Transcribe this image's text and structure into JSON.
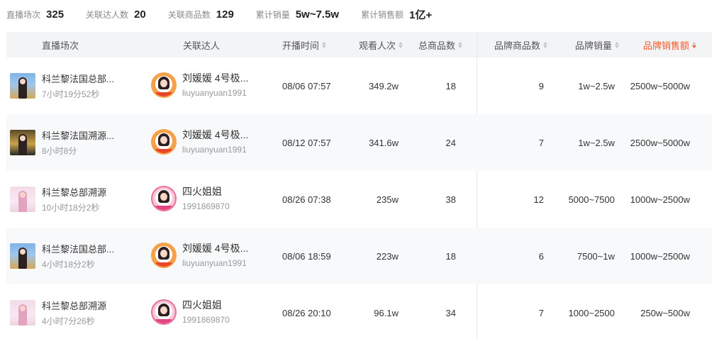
{
  "summary": [
    {
      "label": "直播场次",
      "value": "325"
    },
    {
      "label": "关联达人数",
      "value": "20"
    },
    {
      "label": "关联商品数",
      "value": "129"
    },
    {
      "label": "累计销量",
      "value": "5w~7.5w"
    },
    {
      "label": "累计销售额",
      "value": "1亿+"
    }
  ],
  "columns": {
    "live": "直播场次",
    "author": "关联达人",
    "start_time": "开播时间",
    "views": "观看人次",
    "total_products": "总商品数",
    "brand_products": "品牌商品数",
    "brand_sales": "品牌销量",
    "brand_revenue": "品牌销售额"
  },
  "active_sort_color": "#f05a28",
  "rows": [
    {
      "thumb": "tv",
      "title": "科兰黎法国总部...",
      "duration": "7小时19分52秒",
      "avatar": "orange",
      "author": "刘媛媛 4号极...",
      "author_id": "liuyuanyuan1991",
      "start_time": "08/06 07:57",
      "views": "349.2w",
      "total_products": "18",
      "brand_products": "9",
      "brand_sales": "1w~2.5w",
      "brand_revenue": "2500w~5000w"
    },
    {
      "thumb": "tv2",
      "title": "科兰黎法国溯源...",
      "duration": "8小时8分",
      "avatar": "orange",
      "author": "刘媛媛 4号极...",
      "author_id": "liuyuanyuan1991",
      "start_time": "08/12 07:57",
      "views": "341.6w",
      "total_products": "24",
      "brand_products": "7",
      "brand_sales": "1w~2.5w",
      "brand_revenue": "2500w~5000w"
    },
    {
      "thumb": "pk",
      "title": "科兰黎总部溯源",
      "duration": "10小时18分2秒",
      "avatar": "pink",
      "author": "四火姐姐",
      "author_id": "1991869870",
      "start_time": "08/26 07:38",
      "views": "235w",
      "total_products": "38",
      "brand_products": "12",
      "brand_sales": "5000~7500",
      "brand_revenue": "1000w~2500w"
    },
    {
      "thumb": "tv",
      "title": "科兰黎法国总部...",
      "duration": "4小时18分2秒",
      "avatar": "orange",
      "author": "刘媛媛 4号极...",
      "author_id": "liuyuanyuan1991",
      "start_time": "08/06 18:59",
      "views": "223w",
      "total_products": "18",
      "brand_products": "6",
      "brand_sales": "7500~1w",
      "brand_revenue": "1000w~2500w"
    },
    {
      "thumb": "pk",
      "title": "科兰黎总部溯源",
      "duration": "4小时7分26秒",
      "avatar": "pink",
      "author": "四火姐姐",
      "author_id": "1991869870",
      "start_time": "08/26 20:10",
      "views": "96.1w",
      "total_products": "34",
      "brand_products": "7",
      "brand_sales": "1000~2500",
      "brand_revenue": "250w~500w"
    }
  ]
}
